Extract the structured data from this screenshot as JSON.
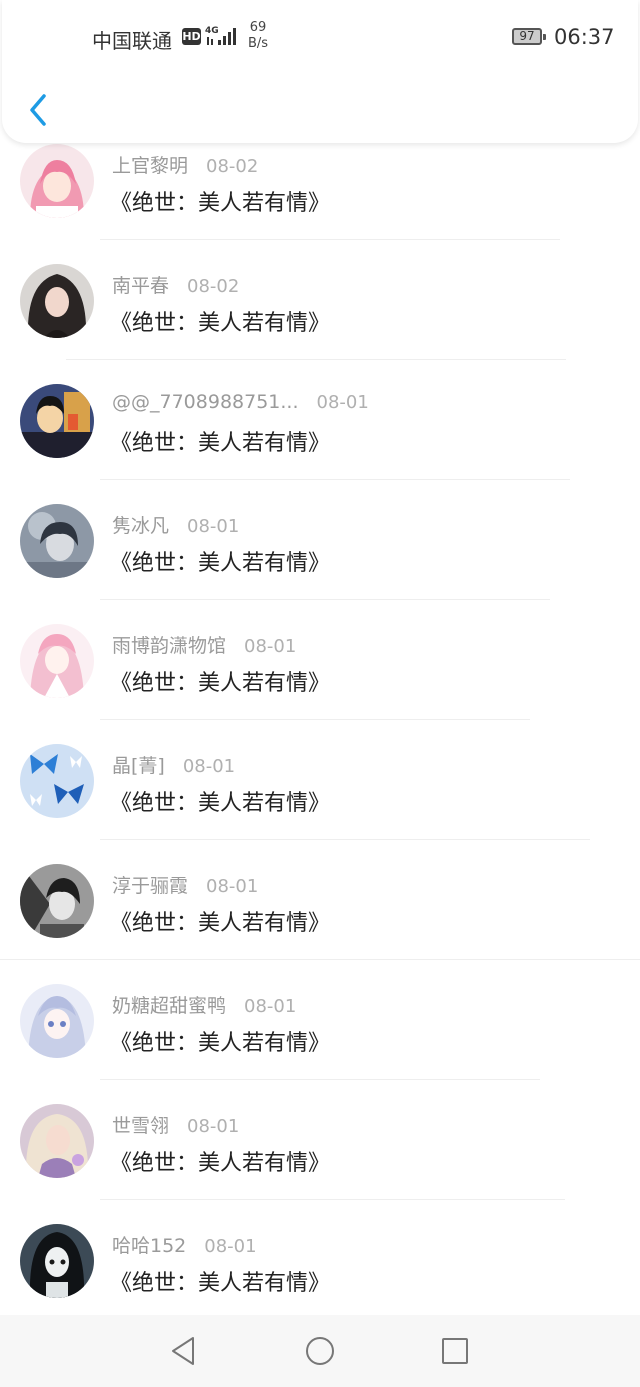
{
  "status_bar": {
    "carrier": "中国联通",
    "hd": "HD",
    "net_speed_value": "69",
    "net_speed_unit": "B/s",
    "battery": "97",
    "time": "06:37"
  },
  "header": {
    "back_icon": "chevron-left-icon"
  },
  "colors": {
    "accent": "#1e9be4",
    "name_text": "#9a9a9a",
    "title_text": "#222222",
    "divider": "#eeeeee"
  },
  "items": [
    {
      "name": "上官黎明",
      "date": "08-02",
      "title": "《绝世：美人若有情》"
    },
    {
      "name": "南平春",
      "date": "08-02",
      "title": "《绝世：美人若有情》"
    },
    {
      "name": "@@_7708988751...",
      "date": "08-01",
      "title": "《绝世：美人若有情》"
    },
    {
      "name": "隽冰凡",
      "date": "08-01",
      "title": "《绝世：美人若有情》"
    },
    {
      "name": "雨博韵潇物馆",
      "date": "08-01",
      "title": "《绝世：美人若有情》"
    },
    {
      "name": "晶[菁]",
      "date": "08-01",
      "title": "《绝世：美人若有情》"
    },
    {
      "name": "淳于骊霞",
      "date": "08-01",
      "title": "《绝世：美人若有情》"
    },
    {
      "name": "奶糖超甜蜜鸭",
      "date": "08-01",
      "title": "《绝世：美人若有情》"
    },
    {
      "name": "世雪翎",
      "date": "08-01",
      "title": "《绝世：美人若有情》"
    },
    {
      "name": "哈哈152",
      "date": "08-01",
      "title": "《绝世：美人若有情》"
    }
  ],
  "nav": {
    "back": "triangle-back-icon",
    "home": "circle-home-icon",
    "recent": "square-recent-icon"
  }
}
